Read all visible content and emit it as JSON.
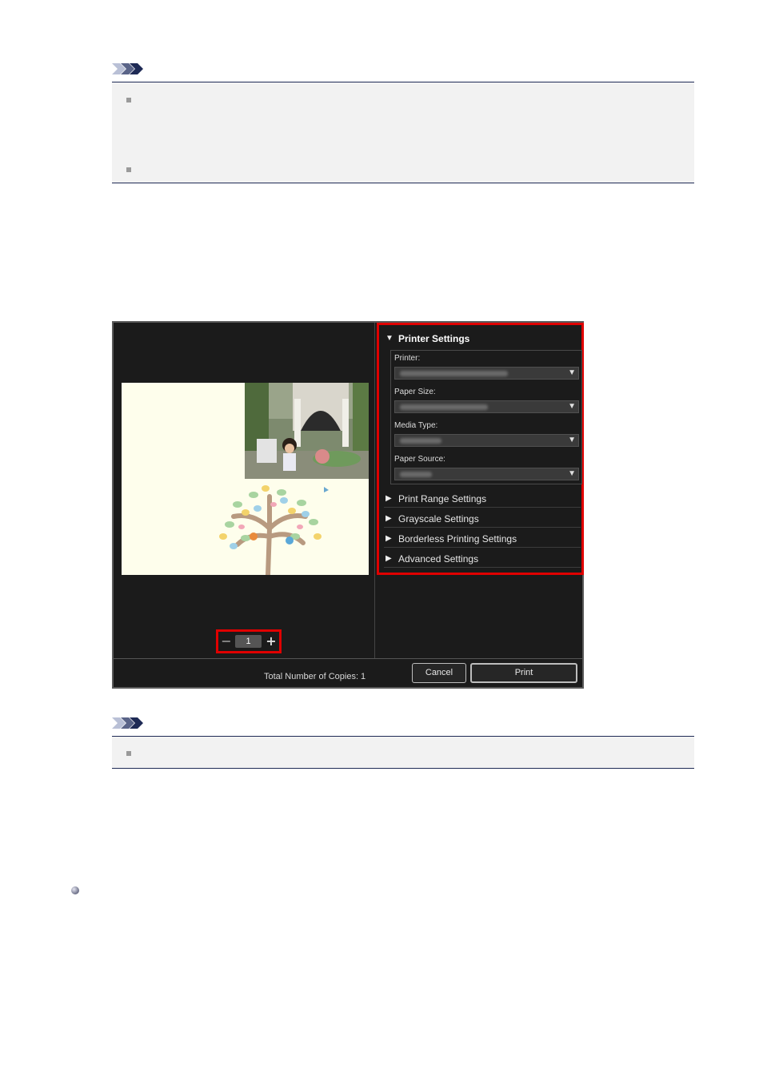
{
  "dialog": {
    "settings_title": "Printer Settings",
    "fields": [
      {
        "label": "Printer:"
      },
      {
        "label": "Paper Size:"
      },
      {
        "label": "Media Type:"
      },
      {
        "label": "Paper Source:"
      }
    ],
    "sections": [
      "Print Range Settings",
      "Grayscale Settings",
      "Borderless Printing Settings",
      "Advanced Settings"
    ],
    "copies_value": "1",
    "total_label": "Total Number of Copies:  1",
    "cancel_label": "Cancel",
    "print_label": "Print"
  },
  "colors": {
    "highlight": "#e00000",
    "note_rule": "#1e2a55",
    "dialog_bg": "#1b1b1b"
  },
  "icons": {
    "note": "note-chevron-icon",
    "bullet": "square-bullet-icon",
    "link": "round-bullet-icon"
  }
}
